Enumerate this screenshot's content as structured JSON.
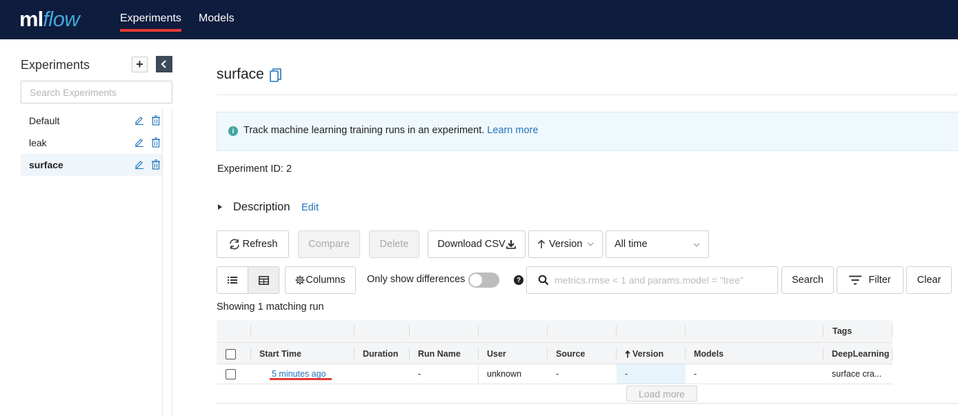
{
  "brand": {
    "ml": "ml",
    "flow": "flow"
  },
  "nav": {
    "experiments": "Experiments",
    "models": "Models"
  },
  "sidebar": {
    "title": "Experiments",
    "add_label": "+",
    "search_placeholder": "Search Experiments",
    "items": [
      {
        "label": "Default"
      },
      {
        "label": "leak"
      },
      {
        "label": "surface"
      }
    ]
  },
  "main": {
    "experiment_name": "surface",
    "info_text": "Track machine learning training runs in an experiment.",
    "info_link": "Learn more",
    "experiment_id_label": "Experiment ID:",
    "experiment_id": "2",
    "description_label": "Description",
    "description_edit": "Edit"
  },
  "toolbar": {
    "refresh": "Refresh",
    "compare": "Compare",
    "delete": "Delete",
    "download_csv": "Download CSV",
    "sort_label": "Version",
    "time_range": "All time",
    "columns": "Columns",
    "only_diff": "Only show differences",
    "search_placeholder": "metrics.rmse < 1 and params.model = \"tree\"",
    "search": "Search",
    "filter": "Filter",
    "clear": "Clear"
  },
  "results": {
    "showing": "Showing 1 matching run"
  },
  "table": {
    "group_header_tags": "Tags",
    "headers": {
      "start_time": "Start Time",
      "duration": "Duration",
      "run_name": "Run Name",
      "user": "User",
      "source": "Source",
      "version": "Version",
      "models": "Models",
      "deeplearning": "DeepLearning"
    },
    "rows": [
      {
        "start_time": "5 minutes ago",
        "duration": "",
        "run_name": "-",
        "user": "unknown",
        "source": "-",
        "version": "-",
        "models": "-",
        "deeplearning": "surface cra..."
      }
    ],
    "load_more": "Load more"
  },
  "colors": {
    "topbar": "#0e1c3d",
    "accent_red": "#e53935",
    "link": "#2374bb",
    "brand_blue": "#43a6dc"
  }
}
